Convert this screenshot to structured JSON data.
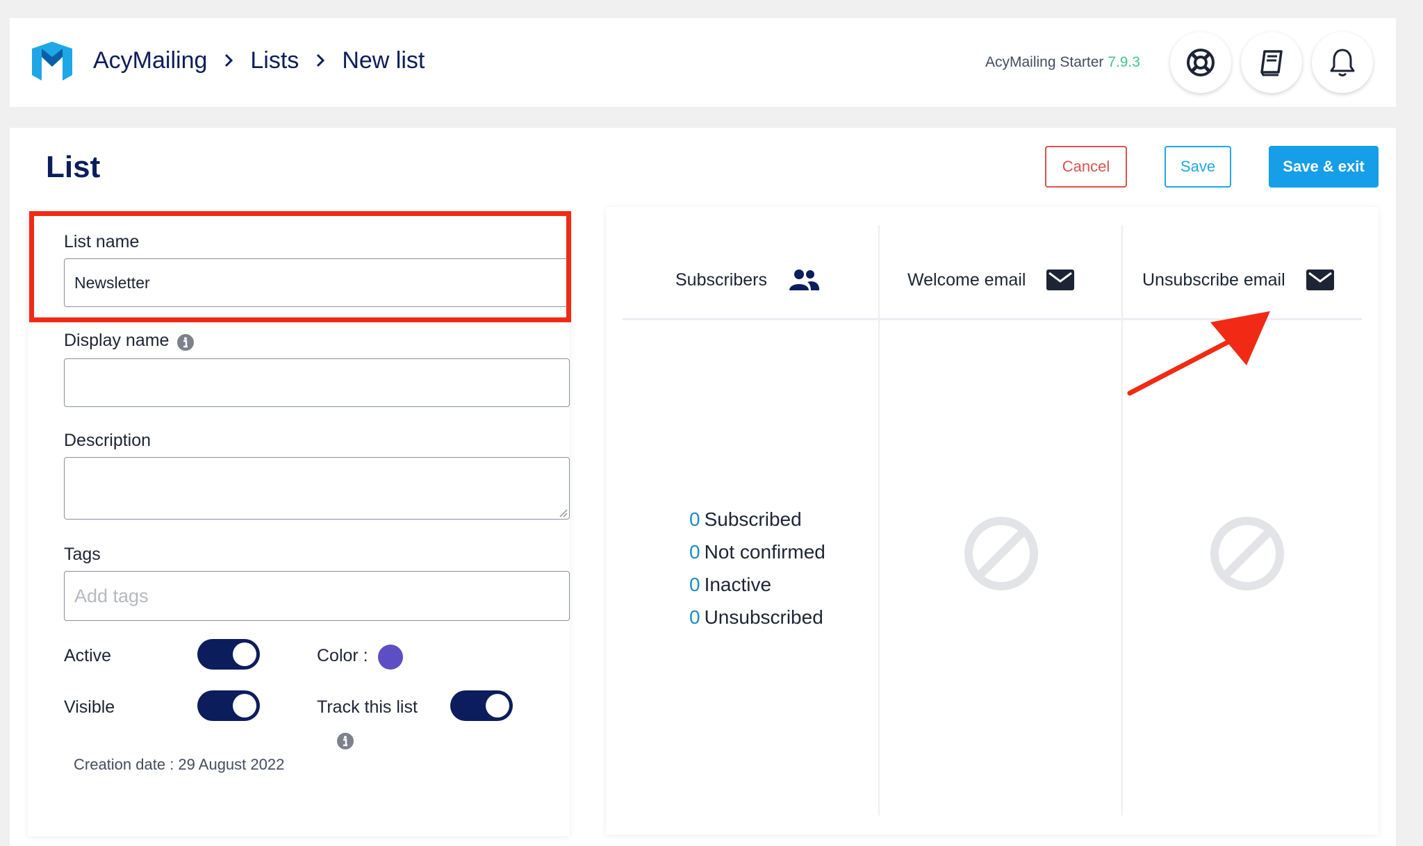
{
  "header": {
    "breadcrumb": [
      "AcyMailing",
      "Lists",
      "New list"
    ],
    "version_label": "AcyMailing Starter",
    "version_number": "7.9.3",
    "icons": [
      "support-icon",
      "documentation-icon",
      "notification-bell-icon"
    ]
  },
  "page": {
    "title": "List",
    "buttons": {
      "cancel": "Cancel",
      "save": "Save",
      "save_exit": "Save & exit"
    }
  },
  "form": {
    "list_name_label": "List name",
    "list_name_value": "Newsletter",
    "display_name_label": "Display name",
    "display_name_value": "",
    "description_label": "Description",
    "description_value": "",
    "tags_label": "Tags",
    "tags_placeholder": "Add tags",
    "active_label": "Active",
    "active_on": true,
    "visible_label": "Visible",
    "visible_on": true,
    "color_label": "Color :",
    "color_value": "#5d4ec4",
    "track_label": "Track this list",
    "track_on": true,
    "creation_date": "Creation date : 29 August 2022"
  },
  "stats": {
    "columns": [
      "Subscribers",
      "Welcome email",
      "Unsubscribe email"
    ],
    "rows": [
      {
        "count": "0",
        "label": "Subscribed"
      },
      {
        "count": "0",
        "label": "Not confirmed"
      },
      {
        "count": "0",
        "label": "Inactive"
      },
      {
        "count": "0",
        "label": "Unsubscribed"
      }
    ]
  },
  "colors": {
    "accent": "#169ee8",
    "danger": "#d9534f",
    "navy": "#0b1d5c",
    "highlight": "#f02a14",
    "version_green": "#3fc58a"
  }
}
